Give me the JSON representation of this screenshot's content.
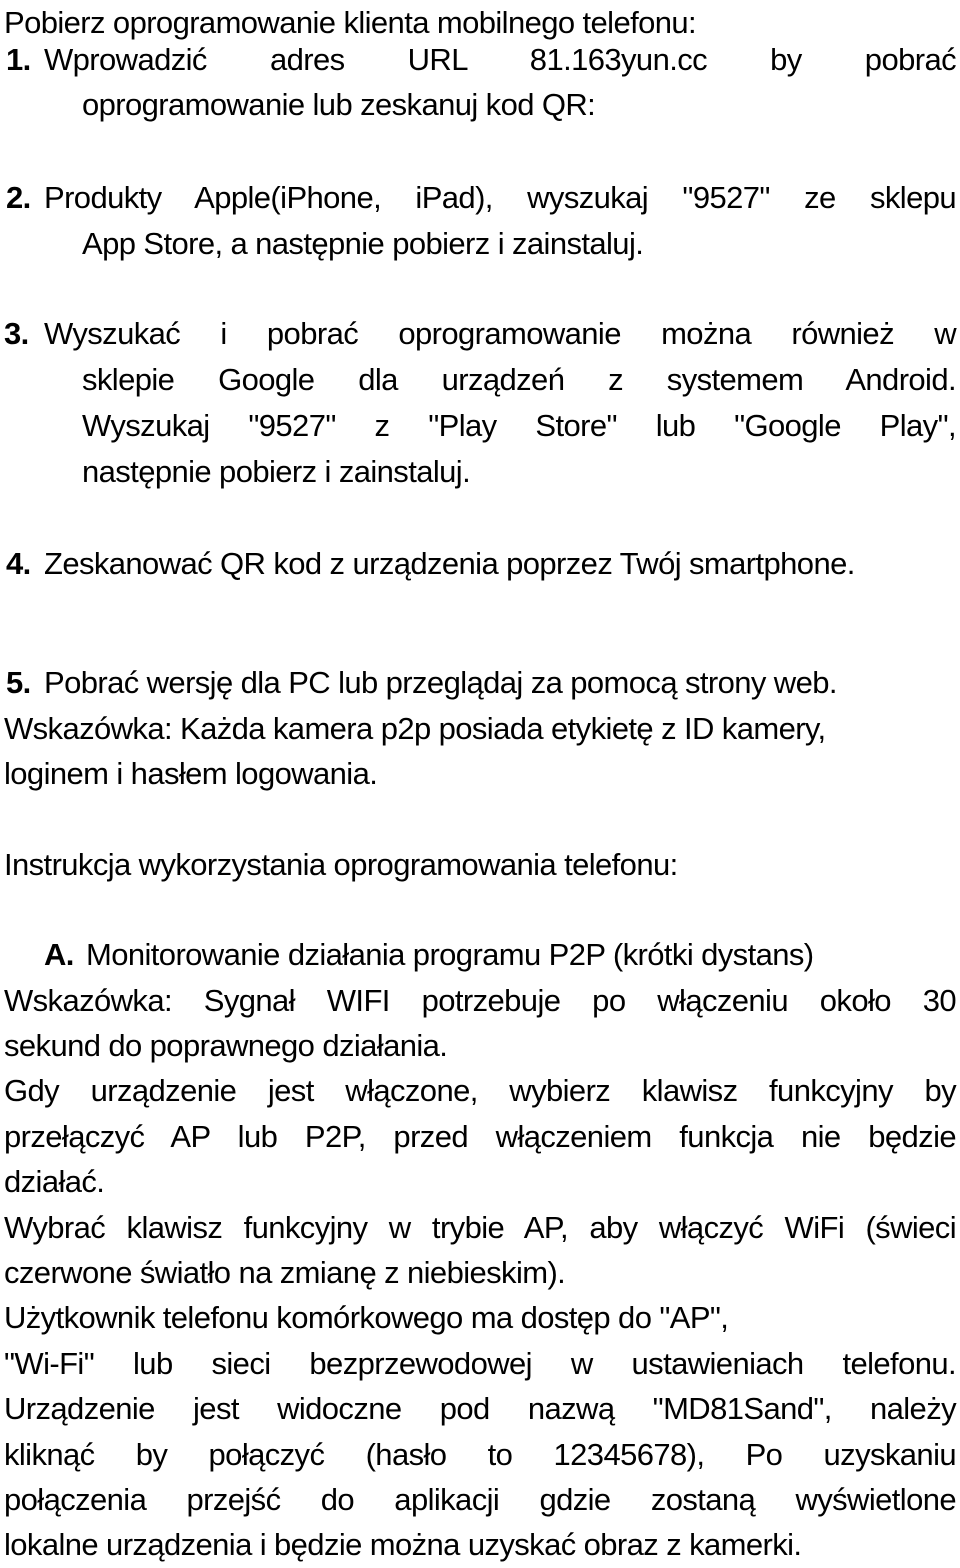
{
  "document": {
    "intro": "Pobierz oprogramowanie klienta mobilnego telefonu:",
    "steps": [
      {
        "number": "1.",
        "lines": [
          "Wprowadzić adres URL 81.163yun.cc by pobrać",
          "oprogramowanie lub zeskanuj kod QR:"
        ]
      },
      {
        "number": "2.",
        "lines": [
          "Produkty Apple(iPhone, iPad), wyszukaj \"9527\" ze sklepu",
          "App Store, a następnie pobierz i zainstaluj."
        ]
      },
      {
        "number": "3.",
        "lines": [
          "Wyszukać i pobrać oprogramowanie można również w",
          "sklepie Google dla urządzeń z systemem Android.",
          "Wyszukaj \"9527\" z \"Play Store\" lub \"Google Play\",",
          "następnie pobierz i zainstaluj."
        ]
      },
      {
        "number": "4.",
        "lines": [
          "Zeskanować QR kod z urządzenia poprzez Twój smartphone."
        ]
      },
      {
        "number": "5.",
        "lines": [
          "Pobrać wersję dla PC lub przeglądaj za pomocą strony web."
        ]
      }
    ],
    "hint1": [
      "Wskazówka: Każda kamera p2p posiada etykietę z ID kamery,",
      "loginem i hasłem logowania."
    ],
    "section_heading": "Instrukcja wykorzystania oprogramowania telefonu:",
    "section_a": {
      "letter": "A.",
      "title": "Monitorowanie działania programu P2P (krótki dystans)"
    },
    "paragraphs": [
      [
        "Wskazówka: Sygnał WIFI potrzebuje po włączeniu około 30",
        "sekund do poprawnego działania."
      ],
      [
        "Gdy urządzenie jest włączone, wybierz klawisz funkcyjny by",
        "przełączyć AP lub P2P, przed włączeniem funkcja nie będzie",
        "działać."
      ],
      [
        "Wybrać klawisz funkcyjny w trybie AP, aby włączyć WiFi (świeci",
        "czerwone światło na zmianę z niebieskim)."
      ],
      [
        "Użytkownik telefonu komórkowego ma dostęp do \"AP\",",
        "\"Wi-Fi\" lub sieci bezprzewodowej w ustawieniach telefonu.",
        "Urządzenie jest widoczne pod nazwą \"MD81Sand\", należy",
        "kliknąć by połączyć (hasło to 12345678), Po uzyskaniu",
        "połączenia przejść do aplikacji gdzie zostaną wyświetlone",
        "lokalne urządzenia i będzie można uzyskać obraz z kamerki."
      ]
    ]
  }
}
